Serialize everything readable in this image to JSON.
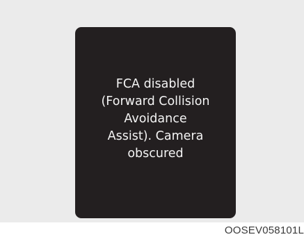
{
  "warning": {
    "lines": [
      "FCA disabled",
      "(Forward Collision",
      "Avoidance",
      "Assist). Camera",
      "obscured"
    ]
  },
  "figure_code": "OOSEV058101L",
  "colors": {
    "background": "#ebebeb",
    "display": "#231f20",
    "display_text": "#f4f4f4",
    "code_text": "#3a3a3a"
  }
}
